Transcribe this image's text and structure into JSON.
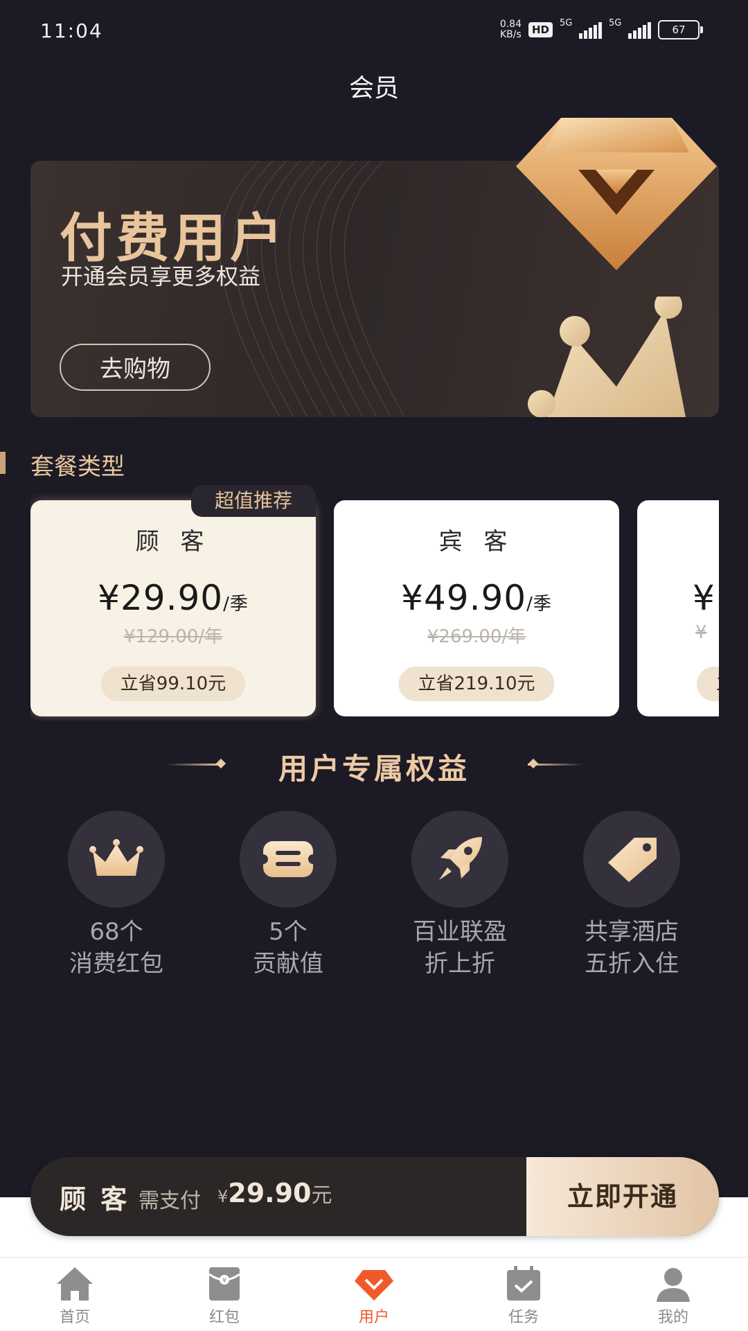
{
  "status_bar": {
    "time": "11:04",
    "net_speed_value": "0.84",
    "net_speed_unit": "KB/s",
    "hd": "HD",
    "sim1": "5G",
    "sim2": "5G",
    "battery": "67"
  },
  "header": {
    "title": "会员"
  },
  "banner": {
    "title": "付费用户",
    "subtitle": "开通会员享更多权益",
    "button": "去购物"
  },
  "section": {
    "title": "套餐类型"
  },
  "plans": [
    {
      "name": "顾 客",
      "price": "¥29.90",
      "unit": "/季",
      "original": "¥129.00/年",
      "save": "立省99.10元",
      "badge": "超值推荐",
      "selected": true
    },
    {
      "name": "宾 客",
      "price": "¥49.90",
      "unit": "/季",
      "original": "¥269.00/年",
      "save": "立省219.10元",
      "selected": false
    },
    {
      "name": "",
      "price": "¥",
      "unit": "",
      "original": "¥",
      "save": "立",
      "selected": false
    }
  ],
  "benefits": {
    "title": "用户专属权益",
    "items": [
      {
        "line1": "68个",
        "line2": "消费红包",
        "icon": "crown-icon"
      },
      {
        "line1": "5个",
        "line2": "贡献值",
        "icon": "ticket-icon"
      },
      {
        "line1": "百业联盈",
        "line2": "折上折",
        "icon": "rocket-icon"
      },
      {
        "line1": "共享酒店",
        "line2": "五折入住",
        "icon": "tag-icon"
      }
    ]
  },
  "pay_bar": {
    "plan": "顾 客",
    "need_pay": "需支付",
    "currency": "¥",
    "amount": "29.90",
    "unit": "元",
    "button": "立即开通"
  },
  "tabs": [
    {
      "label": "首页",
      "icon": "home-icon",
      "active": false
    },
    {
      "label": "红包",
      "icon": "red-envelope-icon",
      "active": false
    },
    {
      "label": "用户",
      "icon": "user-diamond-icon",
      "active": true
    },
    {
      "label": "任务",
      "icon": "calendar-check-icon",
      "active": false
    },
    {
      "label": "我的",
      "icon": "person-icon",
      "active": false
    }
  ],
  "colors": {
    "background": "#1c1a25",
    "gold": "#e8c59d",
    "active_tab": "#f05a2a"
  }
}
